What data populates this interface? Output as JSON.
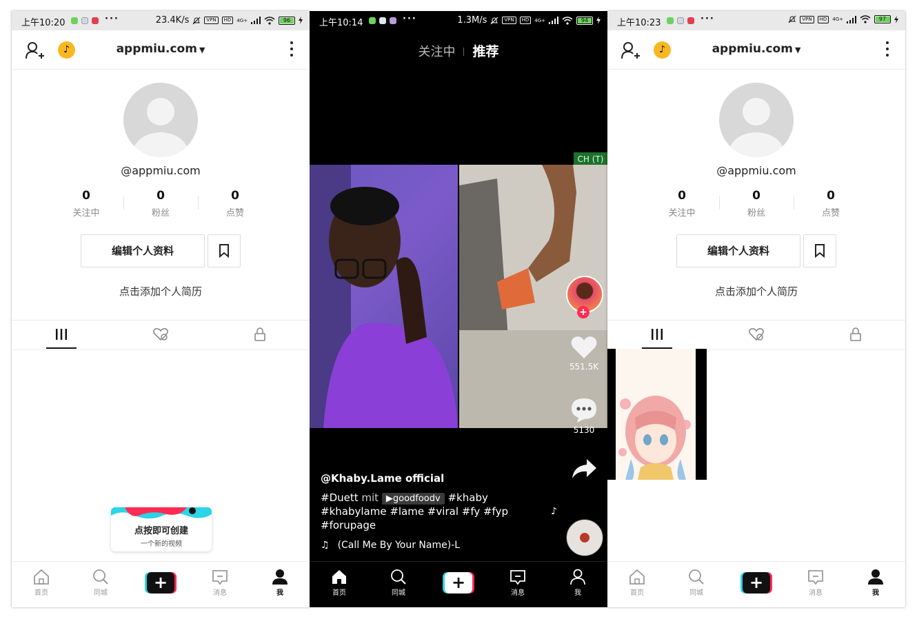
{
  "colors": {
    "accent_red": "#fe2c55",
    "accent_cyan": "#2bd4e6",
    "coin_yellow": "#f9b822"
  },
  "profile_left": {
    "status": {
      "time": "上午10:20",
      "speed": "23.4K/s",
      "vpn": "VPN",
      "hd": "HD",
      "net": "4G+",
      "battery": "96"
    },
    "username": "appmiu.com",
    "handle": "@appmiu.com",
    "stats": [
      {
        "num": "0",
        "label": "关注中"
      },
      {
        "num": "0",
        "label": "粉丝"
      },
      {
        "num": "0",
        "label": "点赞"
      }
    ],
    "edit_button": "编辑个人资料",
    "bio_prompt": "点击添加个人简历",
    "tooltip": {
      "title": "点按即可创建",
      "sub": "一个新的视频"
    },
    "nav": {
      "home": "首页",
      "nearby": "同城",
      "create": "+",
      "inbox": "消息",
      "me": "我"
    }
  },
  "feed": {
    "status": {
      "time": "上午10:14",
      "speed": "1.3M/s",
      "vpn": "VPN",
      "hd": "HD",
      "net": "4G+",
      "battery": "94"
    },
    "tab_following": "关注中",
    "tab_recommended": "推荐",
    "ch_tag": "CH (T)",
    "likes": "551.5K",
    "comments": "5130",
    "author": "@Khaby.Lame official",
    "duet_tag": "#Duett",
    "duet_word": "mit",
    "duet_chip": "▶goodfoodv",
    "tags_line1_end": "#khaby",
    "tags_line2": "#khabylame #lame #viral #fy #fyp",
    "tags_line3": "#forupage",
    "music_title": "(Call Me By Your Name)-L",
    "nav": {
      "home": "首页",
      "nearby": "同城",
      "create": "+",
      "inbox": "消息",
      "me": "我"
    }
  },
  "profile_right": {
    "status": {
      "time": "上午10:23",
      "vpn": "VPN",
      "hd": "HD",
      "net": "4G+",
      "battery": "97"
    },
    "username": "appmiu.com",
    "handle": "@appmiu.com",
    "stats": [
      {
        "num": "0",
        "label": "关注中"
      },
      {
        "num": "0",
        "label": "粉丝"
      },
      {
        "num": "0",
        "label": "点赞"
      }
    ],
    "edit_button": "编辑个人资料",
    "bio_prompt": "点击添加个人简历",
    "nav": {
      "home": "首页",
      "nearby": "同城",
      "create": "+",
      "inbox": "消息",
      "me": "我"
    }
  }
}
